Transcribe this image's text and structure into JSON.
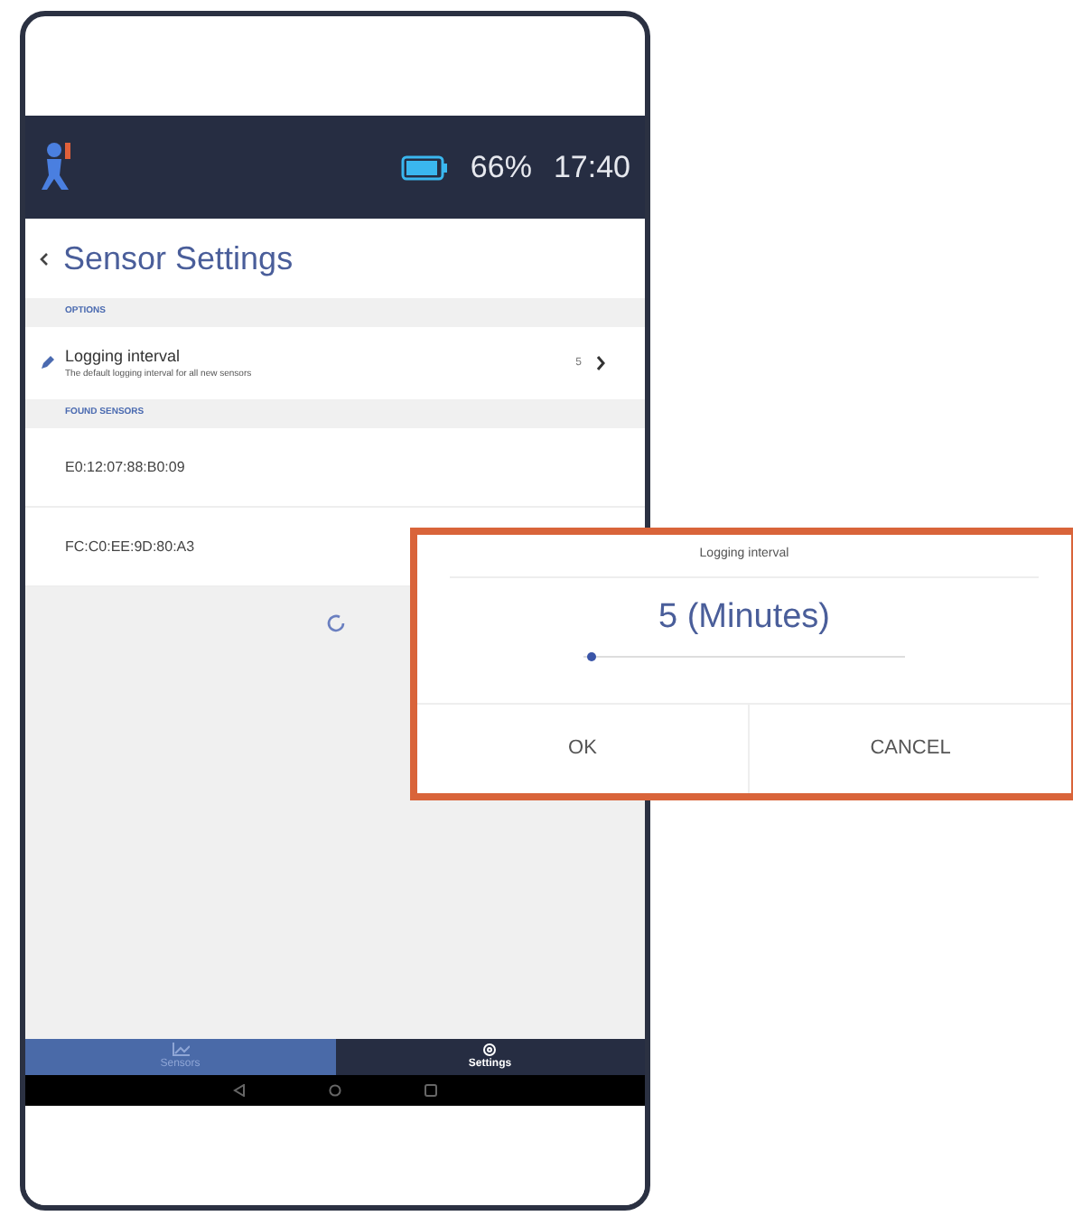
{
  "status": {
    "battery_percent": "66%",
    "time": "17:40"
  },
  "page": {
    "title": "Sensor Settings"
  },
  "sections": [
    {
      "heading": "OPTIONS",
      "items": [
        {
          "kind": "setting",
          "label": "Logging interval",
          "description": "The default logging interval for all new sensors",
          "value": "5"
        }
      ]
    },
    {
      "heading": "FOUND SENSORS",
      "items": [
        {
          "kind": "sensor",
          "label": "E0:12:07:88:B0:09"
        },
        {
          "kind": "sensor",
          "label": "FC:C0:EE:9D:80:A3"
        }
      ]
    }
  ],
  "tabs": [
    {
      "label": "Sensors",
      "selected": false
    },
    {
      "label": "Settings",
      "selected": true
    }
  ],
  "dialog": {
    "title": "Logging interval",
    "value": "5 (Minutes)",
    "level": 0.02,
    "buttons": [
      "OK",
      "CANCEL"
    ]
  }
}
